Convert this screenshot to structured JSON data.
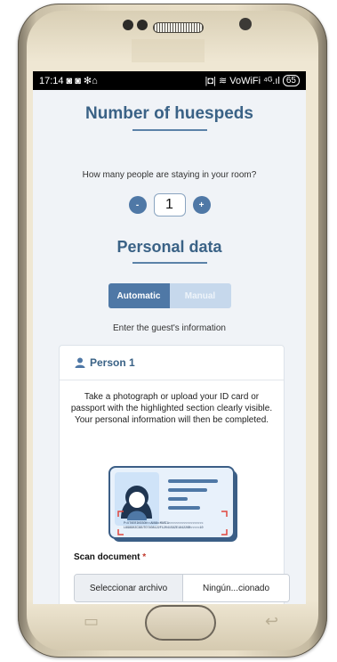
{
  "status_bar": {
    "time": "17:14",
    "left_icons": "◙ ◙ ✻⌂",
    "right_icons": "|◘| ≋ VoWiFi ⁴ᴳ.ıl",
    "battery": "65"
  },
  "huespeds": {
    "title": "Number of huespeds",
    "question": "How many people are staying in your room?",
    "decrement_label": "-",
    "count": "1",
    "increment_label": "+"
  },
  "personal_data": {
    "title": "Personal data",
    "mode_automatic": "Automatic",
    "mode_manual": "Manual",
    "instruction": "Enter the guest's information"
  },
  "person_card": {
    "title": "Person 1",
    "description": "Take a photograph or upload your ID card or passport with the highlighted section clearly visible. Your personal information will then be completed.",
    "mrz_line1": "P<UTOERIKSSON<<ANNA<MARIA<<<<<<<<<<<<<<<<<<<",
    "mrz_line2": "L898902C36UTO7408122F1204159ZE184226B<<<<<10",
    "scan_label": "Scan document",
    "required_mark": "*",
    "file_button": "Seleccionar archivo",
    "file_name": "Ningún...cionado"
  },
  "colors": {
    "primary": "#4f78a6",
    "title": "#3a6286",
    "background": "#f0f3f7",
    "manual_inactive": "#c6d8ec"
  }
}
